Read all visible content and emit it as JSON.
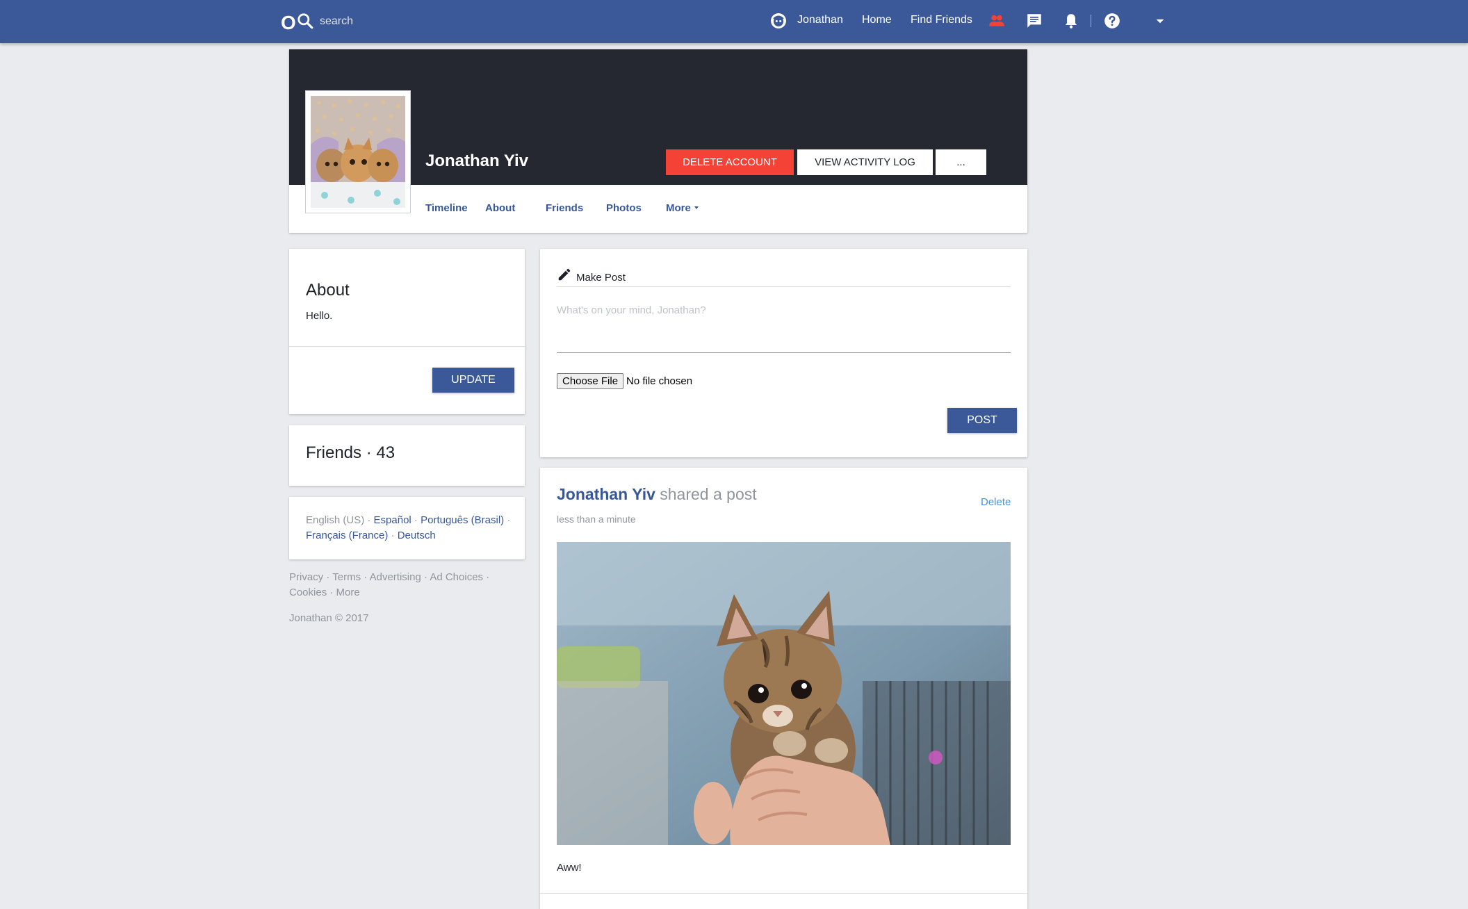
{
  "topbar": {
    "logo": "O",
    "search_placeholder": "search",
    "user_name": "Jonathan",
    "home": "Home",
    "find_friends": "Find Friends"
  },
  "profile": {
    "name": "Jonathan Yiv",
    "delete_account": "DELETE ACCOUNT",
    "view_activity_log": "VIEW ACTIVITY LOG",
    "more_actions": "...",
    "tabs": {
      "timeline": "Timeline",
      "about": "About",
      "friends": "Friends",
      "photos": "Photos",
      "more": "More"
    }
  },
  "about": {
    "title": "About",
    "text": "Hello.",
    "update": "UPDATE"
  },
  "friends": {
    "title": "Friends · 43"
  },
  "languages": {
    "current": "English (US)",
    "es": "Español",
    "pt": "Português (Brasil)",
    "fr": "Français (France)",
    "de": "Deutsch"
  },
  "footer": {
    "privacy": "Privacy",
    "terms": "Terms",
    "advertising": "Advertising",
    "ad_choices": "Ad Choices",
    "cookies": "Cookies",
    "more": "More",
    "copyright": "Jonathan © 2017"
  },
  "make_post": {
    "label": "Make Post",
    "placeholder": "What's on your mind, Jonathan?",
    "choose_file": "Choose File",
    "file_status": "No file chosen",
    "post": "POST"
  },
  "post": {
    "author": "Jonathan Yiv",
    "action": "shared a post",
    "delete": "Delete",
    "time": "less than a minute",
    "caption": "Aww!"
  },
  "colors": {
    "brand": "#3b5998",
    "danger": "#f44336",
    "link": "#365899",
    "cover": "#252830"
  }
}
